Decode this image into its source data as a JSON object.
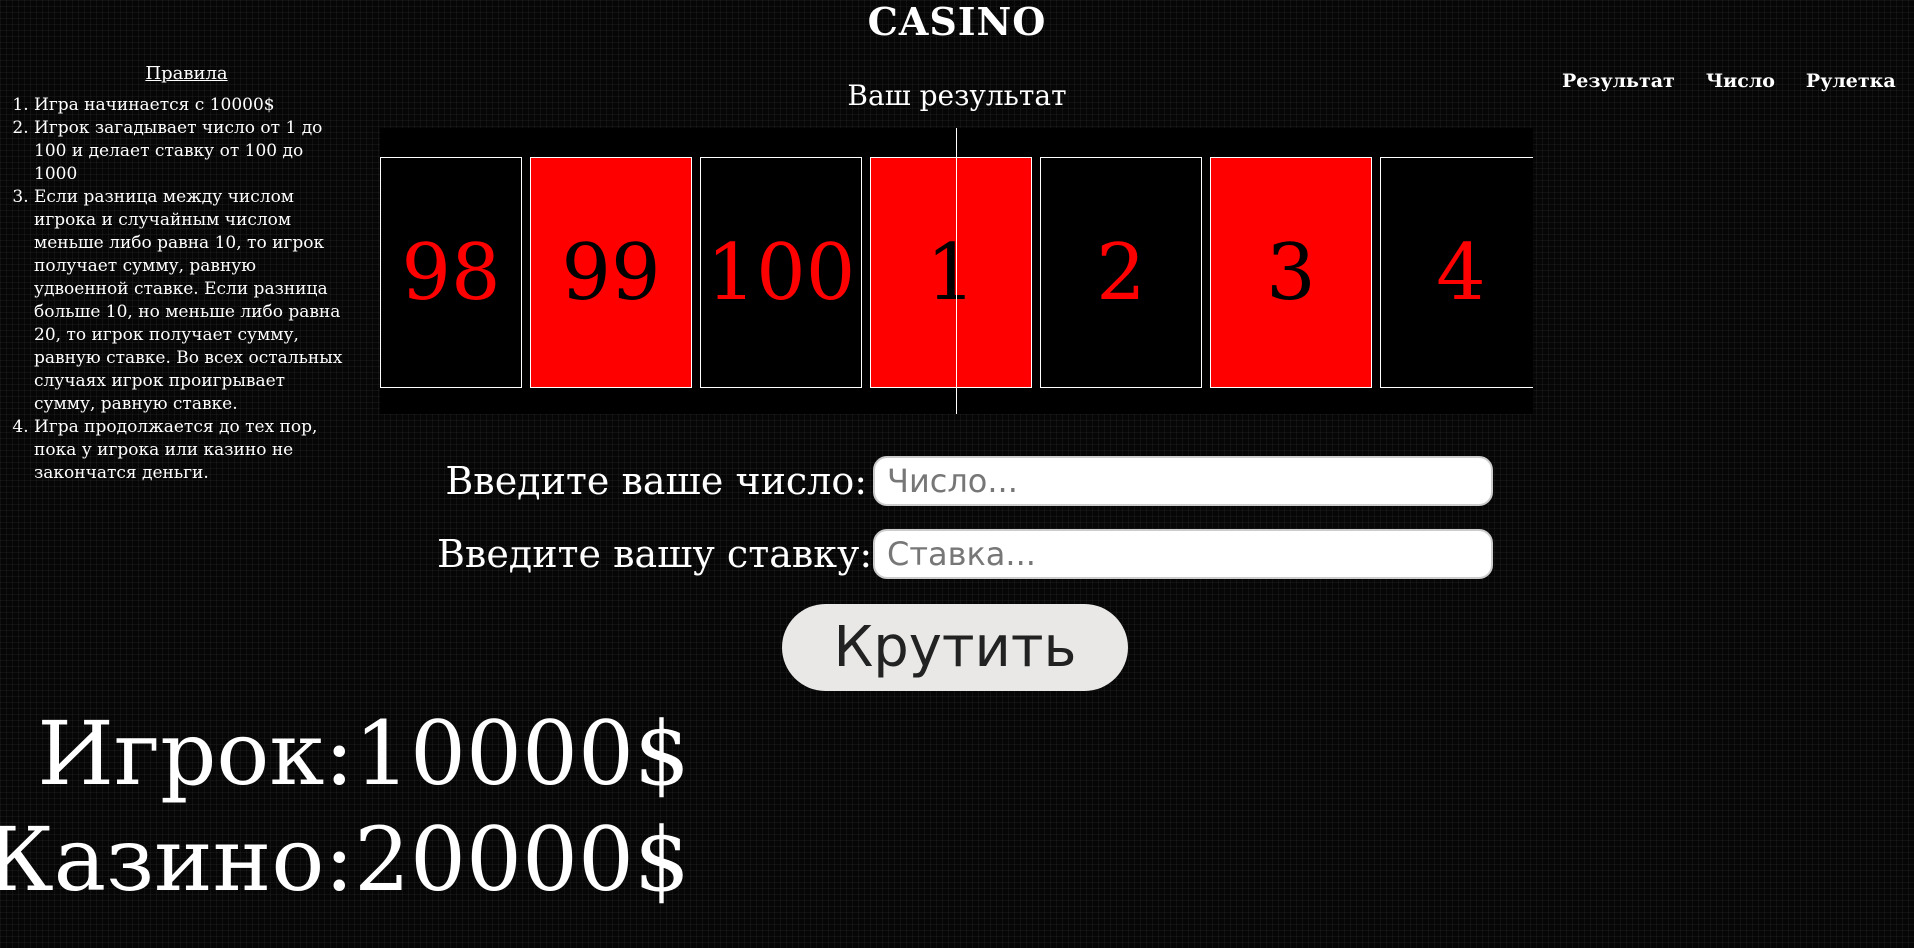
{
  "header": {
    "title": "CASINO"
  },
  "nav": {
    "items": [
      {
        "label": "Результат"
      },
      {
        "label": "Число"
      },
      {
        "label": "Рулетка"
      }
    ]
  },
  "rules": {
    "title": "Правила",
    "items": [
      "Игра начинается с 10000$",
      "Игрок загадывает число от 1 до 100 и делает ставку от 100 до 1000",
      "Если разница между числом игрока и случайным числом меньше либо равна 10, то игрок получает сумму, равную удвоенной ставке. Если разница больше 10, но меньше либо равна 20, то игрок получает сумму, равную ставке. Во всех остальных случаях игрок проигрывает сумму, равную ставке.",
      "Игра продолжается до тех пор, пока у игрока или казино не закончатся деньги."
    ]
  },
  "result": {
    "title": "Ваш результат"
  },
  "roulette": {
    "cells": [
      {
        "number": "98",
        "color": "black"
      },
      {
        "number": "99",
        "color": "red"
      },
      {
        "number": "100",
        "color": "black"
      },
      {
        "number": "1",
        "color": "red"
      },
      {
        "number": "2",
        "color": "black"
      },
      {
        "number": "3",
        "color": "red"
      },
      {
        "number": "4",
        "color": "black"
      }
    ]
  },
  "form": {
    "number_label": "Введите ваше число:",
    "number_placeholder": "Число...",
    "number_value": "",
    "bet_label": "Введите вашу ставку:",
    "bet_placeholder": "Ставка...",
    "bet_value": "",
    "spin_label": "Крутить"
  },
  "balances": {
    "player_label": "Игрок:",
    "player_value": "10000$",
    "casino_label": "Казино:",
    "casino_value": "20000$"
  },
  "colors": {
    "red": "#ff0000",
    "black": "#000000",
    "background": "#060606"
  }
}
